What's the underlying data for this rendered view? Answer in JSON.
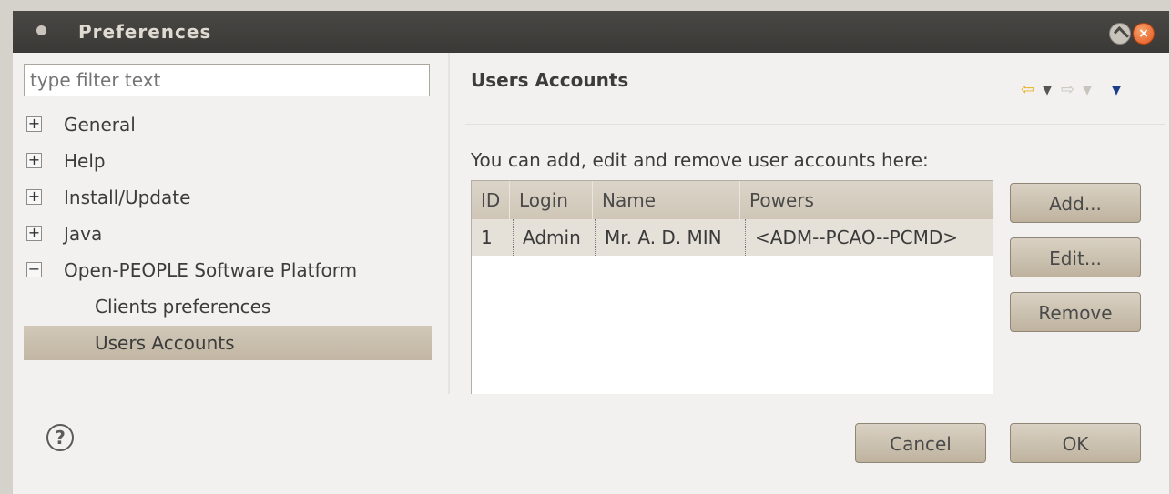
{
  "window": {
    "title": "Preferences"
  },
  "filter": {
    "placeholder": "type filter text"
  },
  "tree": {
    "items": [
      {
        "label": "General",
        "expander": "+"
      },
      {
        "label": "Help",
        "expander": "+"
      },
      {
        "label": "Install/Update",
        "expander": "+"
      },
      {
        "label": "Java",
        "expander": "+"
      },
      {
        "label": "Open-PEOPLE Software Platform",
        "expander": "−"
      },
      {
        "label": "Clients preferences"
      },
      {
        "label": "Users Accounts",
        "selected": true
      }
    ]
  },
  "page": {
    "title": "Users Accounts",
    "description": "You can add, edit and remove user accounts here:",
    "nav": {
      "back": "⇦",
      "back_dropdown": "▼",
      "forward": "⇨",
      "forward_dropdown": "▼",
      "menu": "▼"
    }
  },
  "table": {
    "columns": [
      "ID",
      "Login",
      "Name",
      "Powers"
    ],
    "rows": [
      [
        "1",
        "Admin",
        "Mr. A. D. MIN",
        "<ADM--PCAO--PCMD>"
      ]
    ]
  },
  "buttons": {
    "add": "Add...",
    "edit": "Edit...",
    "remove": "Remove",
    "cancel": "Cancel",
    "ok": "OK"
  },
  "icons": {
    "help": "?",
    "close": "×"
  },
  "colors": {
    "titlebar": "#3f3d3a",
    "selection": "#c9beac",
    "close_button": "#e2541c",
    "nav_back": "#e7b421"
  }
}
